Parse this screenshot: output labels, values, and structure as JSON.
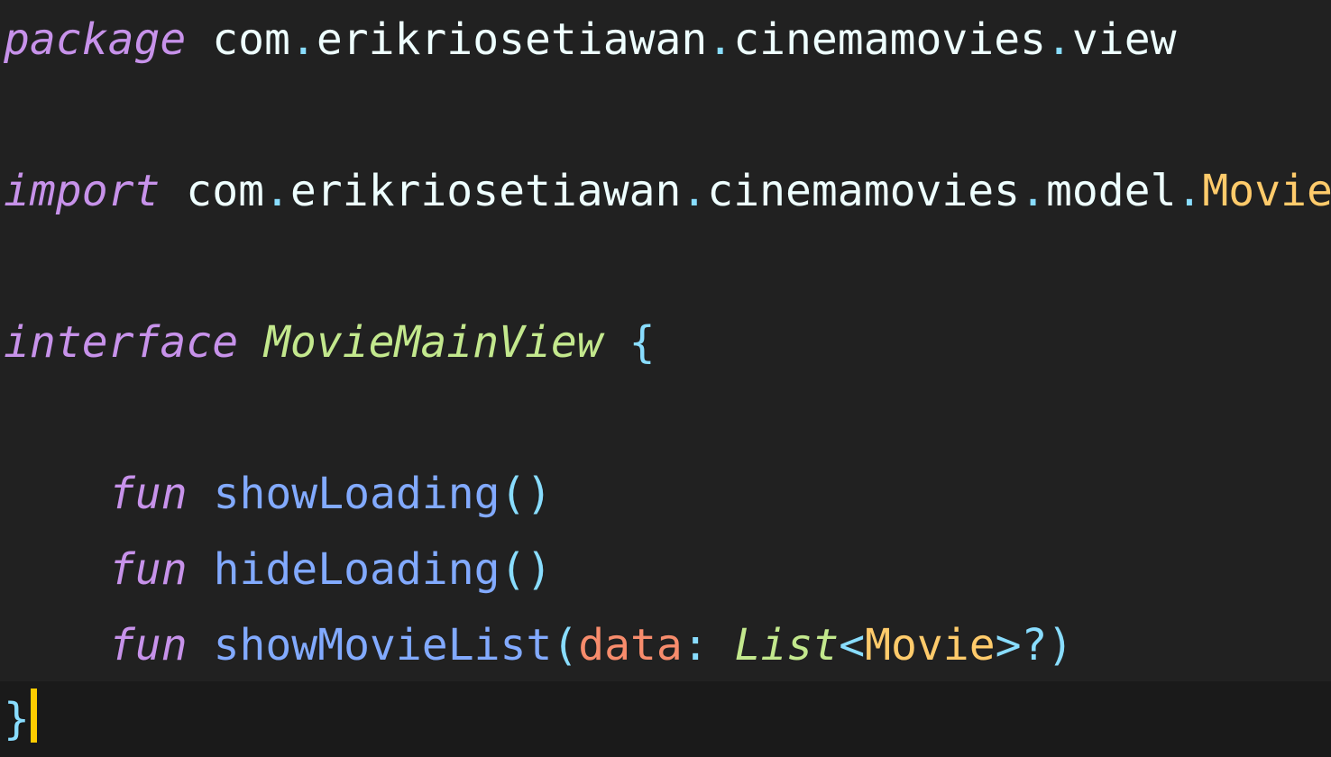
{
  "editor": {
    "language": "kotlin",
    "theme_colors": {
      "background": "#212121",
      "current_line": "#1a1a1a",
      "keyword": "#c792ea",
      "type": "#c3e88d",
      "class": "#ffcb6b",
      "function": "#82aaff",
      "punctuation": "#89ddff",
      "parameter": "#f78c6c",
      "text": "#eeffff",
      "cursor": "#ffcc00"
    },
    "lines": [
      {
        "tokens": {
          "kw_package": "package",
          "space": " ",
          "pkg_1": "com",
          "dot_1": ".",
          "pkg_2": "erikriosetiawan",
          "dot_2": ".",
          "pkg_3": "cinemamovies",
          "dot_3": ".",
          "pkg_4": "view"
        }
      },
      {
        "tokens": {
          "kw_import": "import",
          "space": " ",
          "pkg_1": "com",
          "dot_1": ".",
          "pkg_2": "erikriosetiawan",
          "dot_2": ".",
          "pkg_3": "cinemamovies",
          "dot_3": ".",
          "pkg_4": "model",
          "dot_4": ".",
          "class": "Movie"
        }
      },
      {
        "tokens": {
          "kw_interface": "interface",
          "space": " ",
          "name": "MovieMainView",
          "space2": " ",
          "brace_open": "{"
        }
      },
      {
        "tokens": {
          "kw_fun": "fun",
          "space": " ",
          "name": "showLoading",
          "parens": "()"
        }
      },
      {
        "tokens": {
          "kw_fun": "fun",
          "space": " ",
          "name": "hideLoading",
          "parens": "()"
        }
      },
      {
        "tokens": {
          "kw_fun": "fun",
          "space": " ",
          "name": "showMovieList",
          "paren_open": "(",
          "param": "data",
          "colon": ": ",
          "type": "List",
          "lt": "<",
          "generic": "Movie",
          "gt": ">",
          "nullable": "?",
          "paren_close": ")"
        }
      },
      {
        "tokens": {
          "brace_close": "}"
        }
      }
    ]
  }
}
